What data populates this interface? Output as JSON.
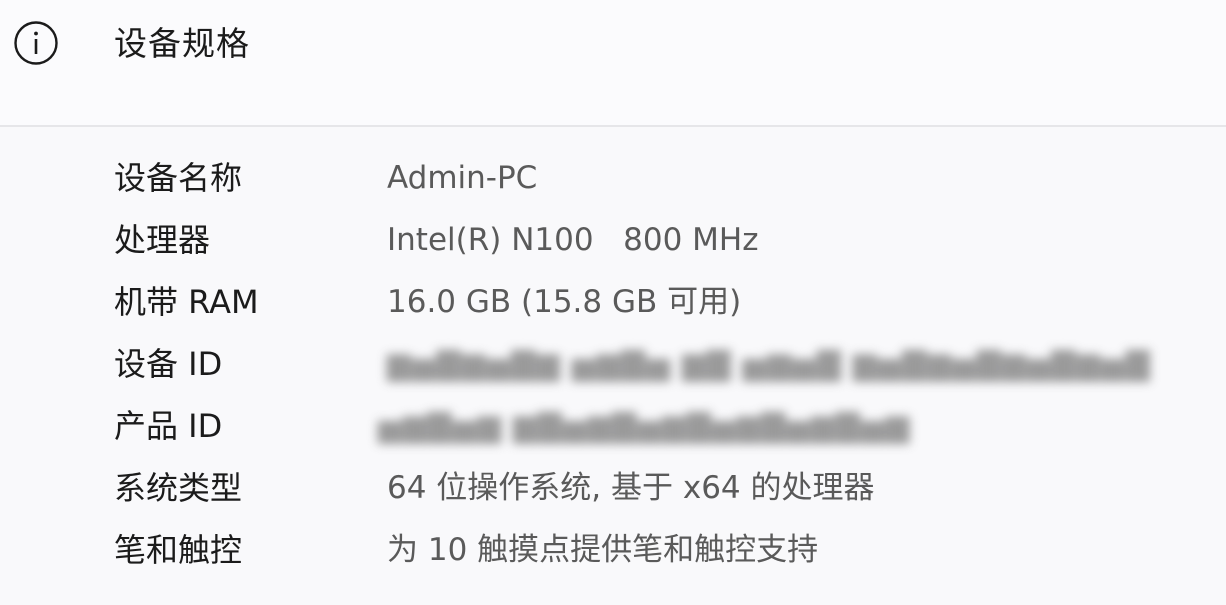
{
  "header": {
    "icon": "info-circle-icon",
    "title": "设备规格"
  },
  "specs": [
    {
      "label": "设备名称",
      "value": "Admin-PC",
      "redacted": false
    },
    {
      "label": "处理器",
      "value": "Intel(R) N100   800 MHz",
      "redacted": false
    },
    {
      "label": "机带 RAM",
      "value": "16.0 GB (15.8 GB 可用)",
      "redacted": false
    },
    {
      "label": "设备 ID",
      "value": "",
      "redacted": true
    },
    {
      "label": "产品 ID",
      "value": "",
      "redacted": true
    },
    {
      "label": "系统类型",
      "value": "64 位操作系统, 基于 x64 的处理器",
      "redacted": false
    },
    {
      "label": "笔和触控",
      "value": "为 10 触摸点提供笔和触控支持",
      "redacted": false
    }
  ],
  "colors": {
    "background": "#fbfbfd",
    "label_text": "#1b1b1b",
    "value_text": "#5a5a5a",
    "divider": "#e6e6e9"
  }
}
